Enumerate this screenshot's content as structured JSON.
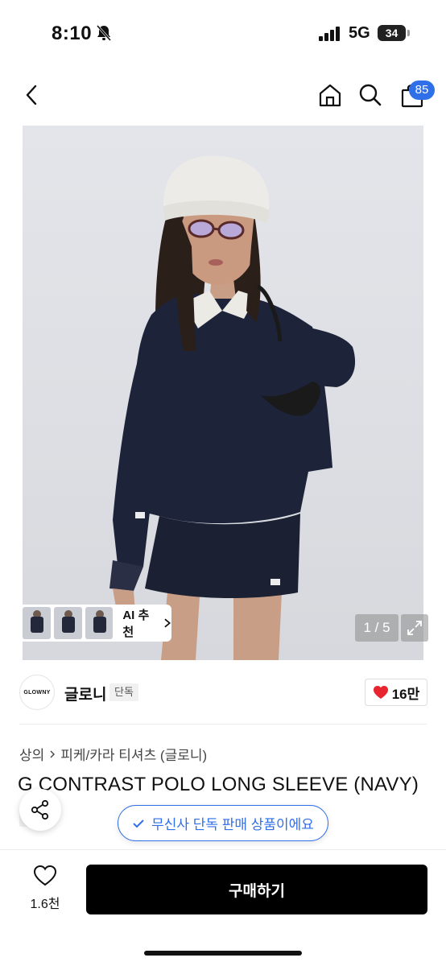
{
  "status_bar": {
    "time": "8:10",
    "network": "5G",
    "battery": "34"
  },
  "nav": {
    "cart_count": "85"
  },
  "gallery": {
    "ai_recommend": "AI 추천",
    "pager": "1 / 5"
  },
  "brand": {
    "logo_text": "GLOWNY",
    "name": "글로니",
    "tag": "단독",
    "likes": "16만"
  },
  "breadcrumb": [
    "상의",
    "피케/카라 티셔츠 (글로니)"
  ],
  "product": {
    "title": "G CONTRAST POLO LONG SLEEVE (NAVY)",
    "tag": "단독"
  },
  "toast": {
    "text": "무신사 단독 판매 상품이에요"
  },
  "bottom": {
    "wish_count": "1.6천",
    "buy_label": "구매하기"
  },
  "colors": {
    "accent": "#2f6fe8",
    "heart": "#e8242e",
    "buy_bg": "#000000"
  }
}
